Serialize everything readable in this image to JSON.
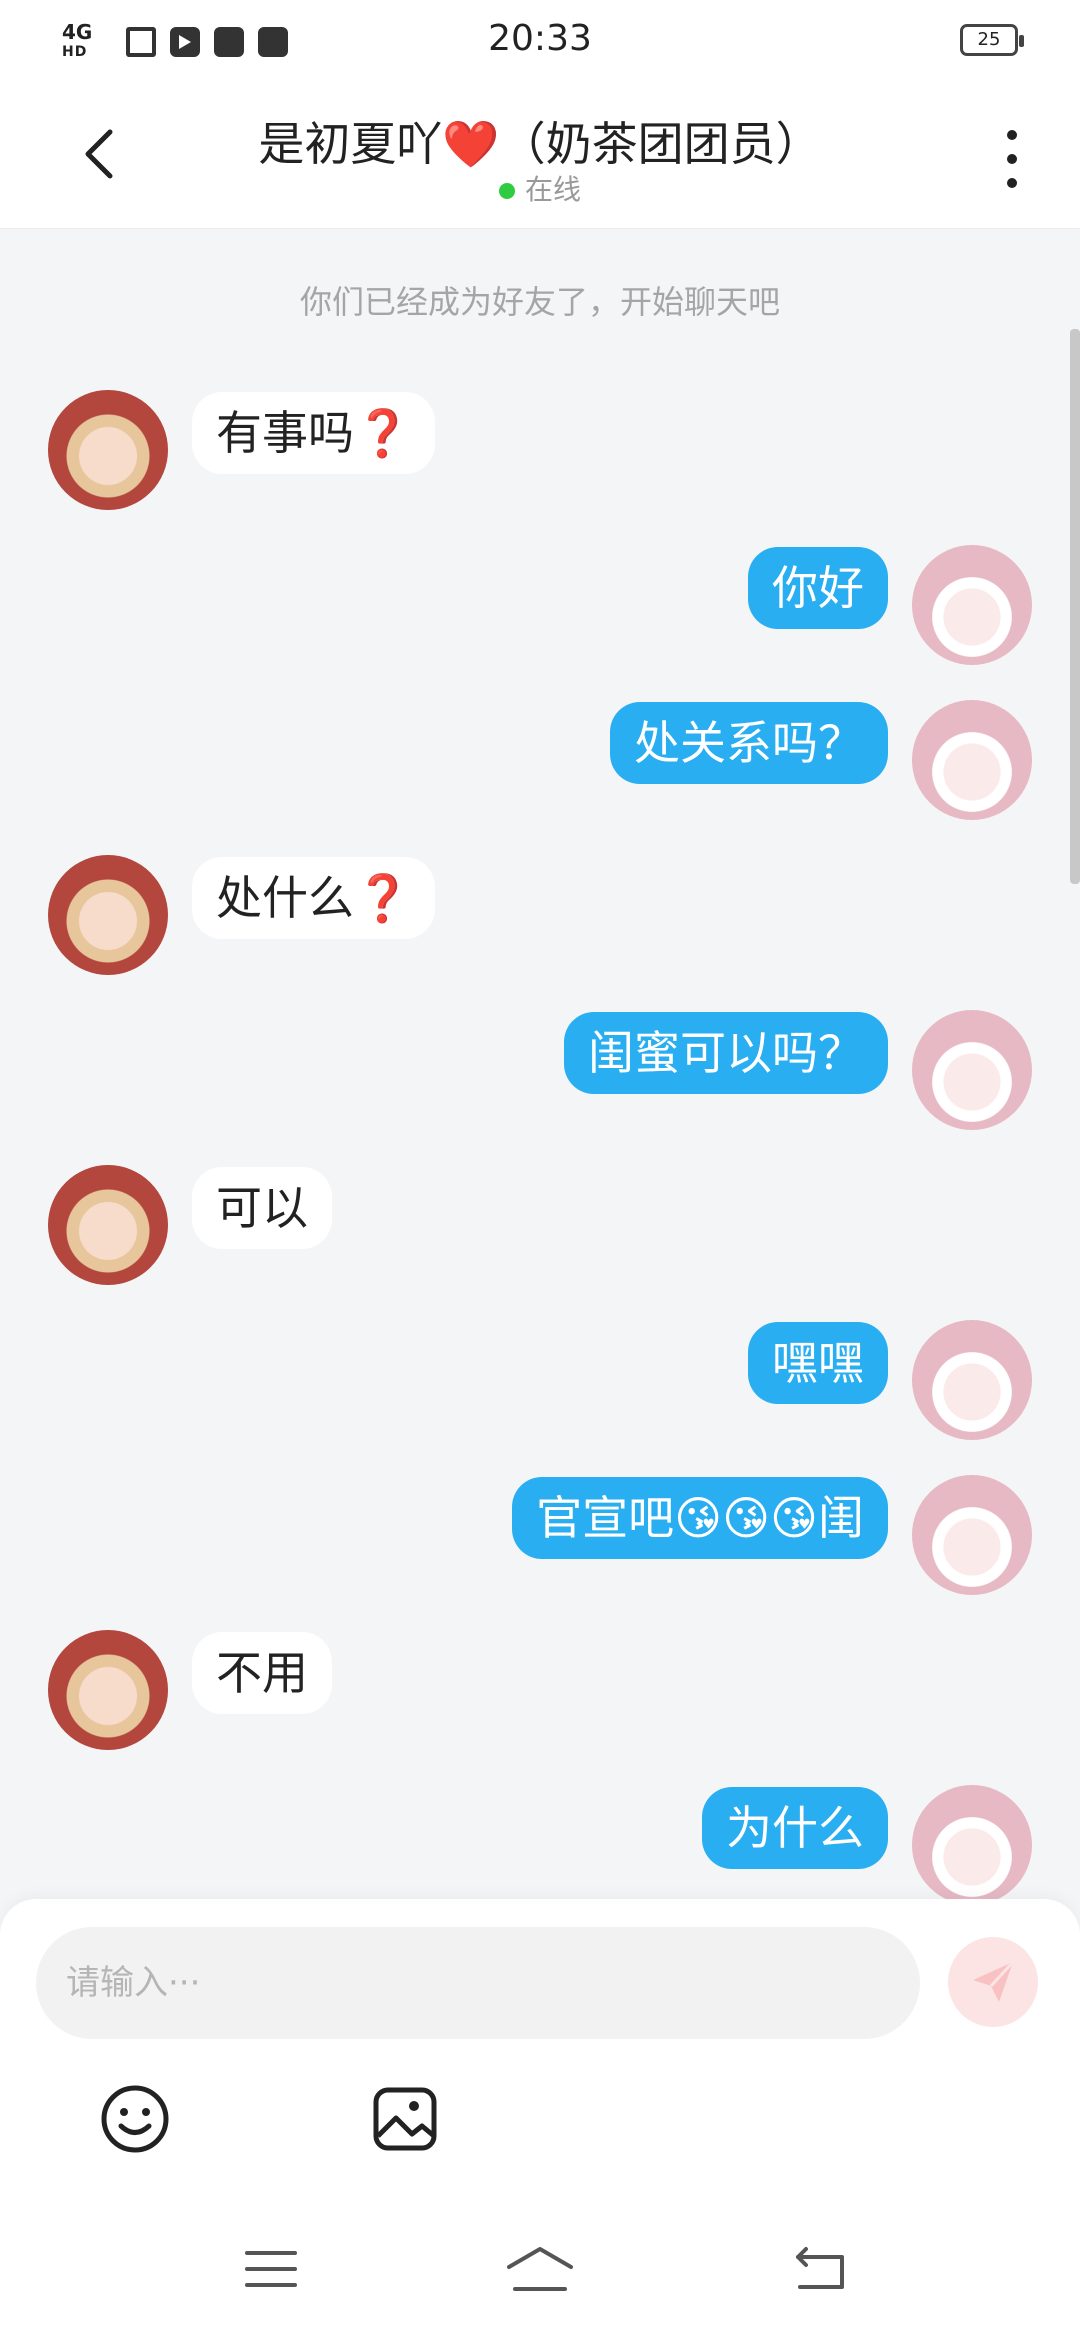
{
  "status_bar": {
    "network": "4G",
    "network_sub": "HD",
    "time": "20:33",
    "battery": "25"
  },
  "header": {
    "title": "是初夏吖❤️（奶茶团团员）",
    "status": "在线"
  },
  "chat": {
    "notice": "你们已经成为好友了，开始聊天吧",
    "messages": [
      {
        "side": "in",
        "text": "有事吗❓"
      },
      {
        "side": "out",
        "text": "你好"
      },
      {
        "side": "out",
        "text": "处关系吗？"
      },
      {
        "side": "in",
        "text": "处什么❓"
      },
      {
        "side": "out",
        "text": "闺蜜可以吗？"
      },
      {
        "side": "in",
        "text": "可以"
      },
      {
        "side": "out",
        "text": "嘿嘿"
      },
      {
        "side": "out",
        "text": "官宣吧😘😘😘闺"
      },
      {
        "side": "in",
        "text": "不用"
      },
      {
        "side": "out",
        "text": "为什么"
      }
    ]
  },
  "composer": {
    "placeholder": "请输入···"
  },
  "colors": {
    "outgoing_bubble": "#29aef2",
    "incoming_bubble": "#ffffff",
    "online_dot": "#2ecc40",
    "send_button": "#fde4e4"
  }
}
